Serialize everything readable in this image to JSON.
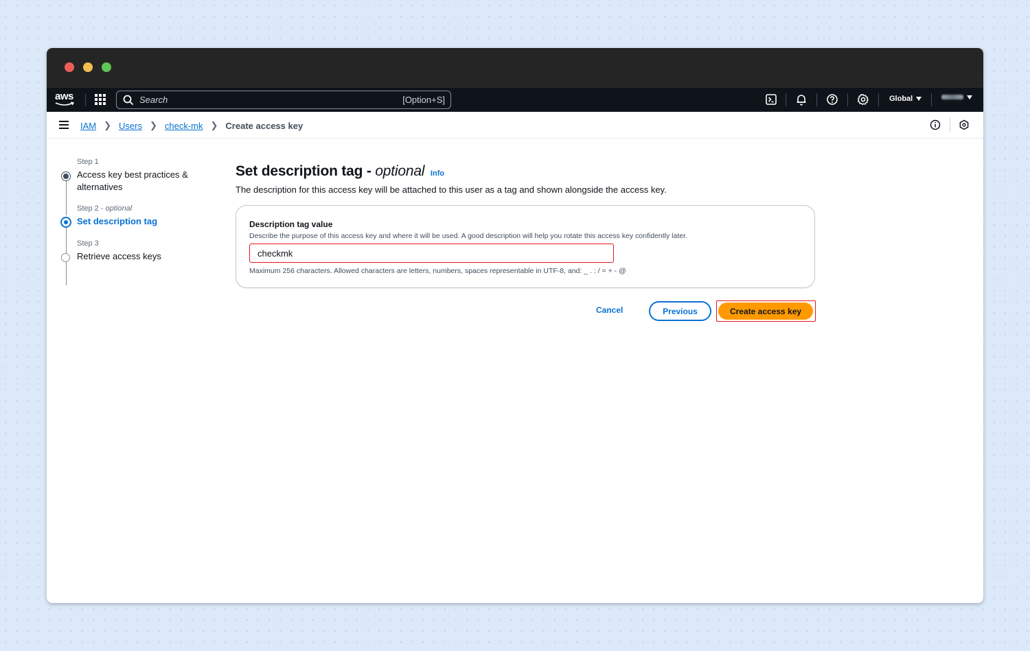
{
  "topnav": {
    "logo_text": "aws",
    "search_placeholder": "Search",
    "search_shortcut": "[Option+S]",
    "region": "Global"
  },
  "breadcrumbs": {
    "items": [
      "IAM",
      "Users",
      "check-mk"
    ],
    "current": "Create access key"
  },
  "steps": [
    {
      "number": "Step 1",
      "title": "Access key best practices & alternatives",
      "state": "completed"
    },
    {
      "number": "Step 2",
      "qualifier": "optional",
      "title": "Set description tag",
      "state": "current"
    },
    {
      "number": "Step 3",
      "title": "Retrieve access keys",
      "state": "pending"
    }
  ],
  "main": {
    "heading": "Set description tag -",
    "heading_optional": "optional",
    "info_link": "Info",
    "description": "The description for this access key will be attached to this user as a tag and shown alongside the access key.",
    "field": {
      "label": "Description tag value",
      "description": "Describe the purpose of this access key and where it will be used. A good description will help you rotate this access key confidently later.",
      "value": "checkmk",
      "hint": "Maximum 256 characters. Allowed characters are letters, numbers, spaces representable in UTF-8, and: _ . : / = + - @"
    }
  },
  "actions": {
    "cancel": "Cancel",
    "previous": "Previous",
    "create": "Create access key"
  },
  "colors": {
    "primary": "#0972d3",
    "cta": "#ff9900",
    "highlight": "#e3161d",
    "nav_bg": "#0f141a"
  }
}
